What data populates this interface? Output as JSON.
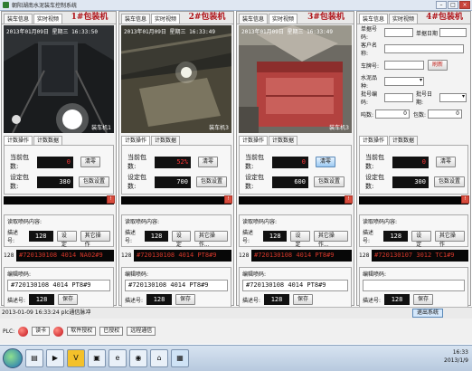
{
  "window": {
    "title": "朝阳湖南水泥装车控制系统"
  },
  "panels": [
    {
      "tabs": [
        "装车信息",
        "实时视频"
      ],
      "title": "1#包装机",
      "cam_time": "2013年01月09日 星期三 16:33:50",
      "cam_label": "装车机1",
      "sub_tabs": [
        "计数操作",
        "计数数据"
      ],
      "cur_label": "当前包数:",
      "cur_value": "0",
      "set_label": "设定包数:",
      "set_value": "380",
      "btn_clear": "清零",
      "btn_bagset": "包数设置",
      "code_title": "读取喷码内容:",
      "tiao_label": "描述号:",
      "tiao_value": "128",
      "btn_set": "设定",
      "btn_other": "其它操作",
      "row_num": "128",
      "code_red": "#720130108 4014 NA02#9",
      "out_title": "编辑喷码:",
      "code_plain": "#720130108 4014 PT8#9",
      "out_label": "描述号:",
      "out_value": "128",
      "btn_save": "保存"
    },
    {
      "tabs": [
        "装车信息",
        "实时视频"
      ],
      "title": "2#包装机",
      "cam_time": "2013年01月09日 星期三 16:33:49",
      "cam_label": "装车机3",
      "sub_tabs": [
        "计数操作",
        "计数数据"
      ],
      "cur_label": "当前包数:",
      "cur_value": "52%",
      "set_label": "设定包数:",
      "set_value": "700",
      "btn_clear": "清零",
      "btn_bagset": "包数设置",
      "code_title": "读取喷码内容:",
      "tiao_label": "描述号:",
      "tiao_value": "128",
      "btn_set": "设定",
      "btn_other": "其它操作...",
      "row_num": "128",
      "code_red": "#720130108 4014 PT8#9",
      "out_title": "编辑喷码:",
      "code_plain": "#720130108 4014 PT8#9",
      "out_label": "描述号:",
      "out_value": "128",
      "btn_save": "保存"
    },
    {
      "tabs": [
        "装车信息",
        "实时视频"
      ],
      "title": "3#包装机",
      "cam_time": "2013年01月09日 星期三 16:33:49",
      "cam_label": "装车机3",
      "sub_tabs": [
        "计数操作",
        "计数数据"
      ],
      "cur_label": "当前包数:",
      "cur_value": "0",
      "set_label": "设定包数:",
      "set_value": "600",
      "btn_clear": "清零",
      "btn_bagset": "包数设置",
      "code_title": "读取喷码内容:",
      "tiao_label": "描述号:",
      "tiao_value": "128",
      "btn_set": "设定",
      "btn_other": "其它操作...",
      "row_num": "128",
      "code_red": "#720130108 4014 PT8#9",
      "out_title": "编辑喷码:",
      "code_plain": "#720130108 4014 PT8#9",
      "out_label": "描述号:",
      "out_value": "128",
      "btn_save": "保存"
    },
    {
      "tabs": [
        "装车信息",
        "实时视频"
      ],
      "title": "4#包装机",
      "form": {
        "cardno": "单据号码:",
        "date": "单据日期",
        "cust": "客户名称:",
        "plate": "车牌号:",
        "btn_refresh": "刷新",
        "cement": "水泥品种:",
        "batch": "批号编码:",
        "batch2": "批号日期:",
        "tons": "吨数:",
        "tons_val": "0",
        "bags": "包数:",
        "bags_val": "0"
      },
      "sub_tabs": [
        "计数操作",
        "计数数据"
      ],
      "cur_label": "当前包数:",
      "cur_value": "0",
      "set_label": "设定包数:",
      "set_value": "300",
      "btn_clear": "清零",
      "btn_bagset": "包数设置",
      "code_title": "读取喷码内容:",
      "tiao_label": "描述号:",
      "tiao_value": "128",
      "btn_set": "设定",
      "btn_other": "其它操作",
      "row_num": "128",
      "code_red": "#720130107 3012 TC1#9",
      "out_title": "编辑喷码:",
      "out_label": "描述号:",
      "out_value": "128",
      "btn_save": "保存"
    }
  ],
  "status": {
    "text": "2013-01-09 16:33:24   plc通信脉冲",
    "btn_exit": "退出系统"
  },
  "plc": {
    "label": "PLC:",
    "read": "读卡",
    "sw1": "软件授权",
    "sw2": "已授权",
    "remote": "远程通信"
  },
  "taskbar": {
    "time": "16:33",
    "date": "2013/1/9"
  }
}
